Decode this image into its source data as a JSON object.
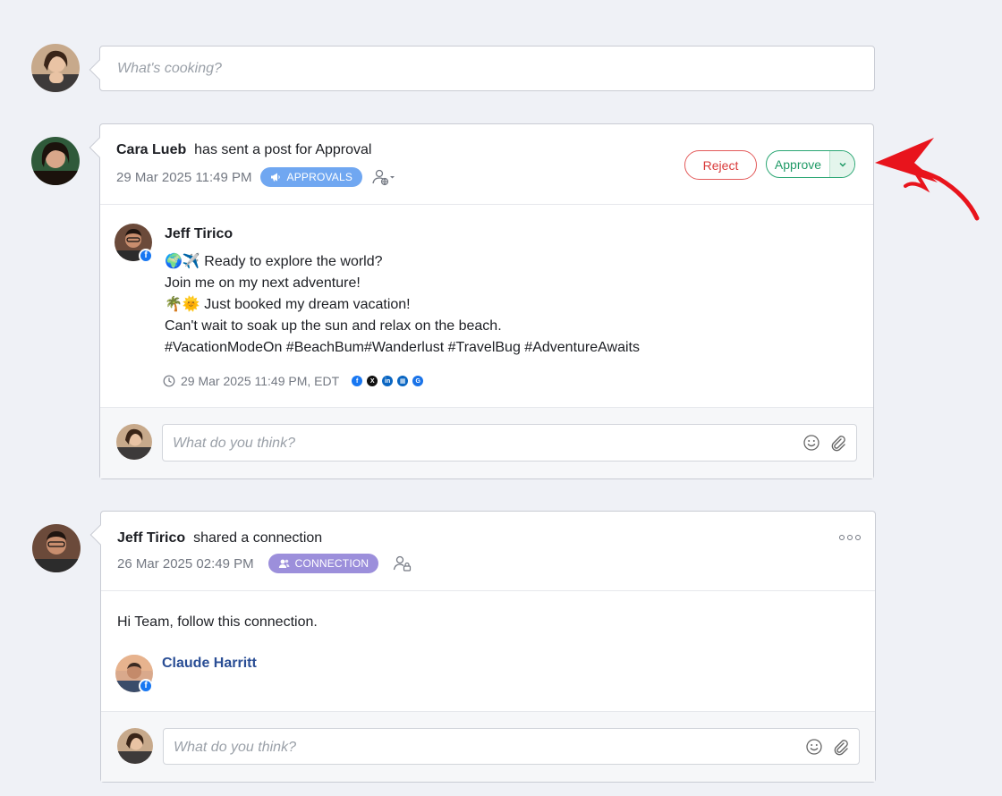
{
  "compose": {
    "placeholder": "What's cooking?"
  },
  "approval_post": {
    "sender": "Cara Lueb",
    "action_text": "has sent a post for Approval",
    "timestamp": "29 Mar 2025 11:49 PM",
    "badge": "APPROVALS",
    "reject_label": "Reject",
    "approve_label": "Approve",
    "content": {
      "author": "Jeff Tirico",
      "lines": [
        "🌍✈️ Ready to explore the world?",
        "Join me on my next adventure!",
        "🌴🌞 Just booked my dream vacation!",
        "Can't wait to soak up the sun and relax on the beach.",
        "#VacationModeOn #BeachBum#Wanderlust #TravelBug #AdventureAwaits"
      ],
      "scheduled": "29 Mar 2025 11:49 PM, EDT",
      "networks": [
        {
          "name": "facebook-icon",
          "glyph": "f",
          "color": "#1877f2"
        },
        {
          "name": "x-icon",
          "glyph": "X",
          "color": "#111111"
        },
        {
          "name": "linkedin-icon",
          "glyph": "in",
          "color": "#0a66c2"
        },
        {
          "name": "linkedin-page-icon",
          "glyph": "▦",
          "color": "#0a66c2"
        },
        {
          "name": "google-business-icon",
          "glyph": "G",
          "color": "#1a73e8"
        }
      ]
    },
    "comment_placeholder": "What do you think?"
  },
  "connection_post": {
    "sender": "Jeff Tirico",
    "action_text": "shared a connection",
    "timestamp": "26 Mar 2025 02:49 PM",
    "badge": "CONNECTION",
    "message": "Hi Team, follow this connection.",
    "connection_name": "Claude Harritt",
    "comment_placeholder": "What do you think?"
  },
  "colors": {
    "approve": "#1f9a66",
    "reject": "#d93b3b",
    "approvals_badge": "#70a7f1",
    "connection_badge": "#9c8fdb",
    "link": "#2a4e95",
    "annotation_arrow": "#e8141c"
  }
}
